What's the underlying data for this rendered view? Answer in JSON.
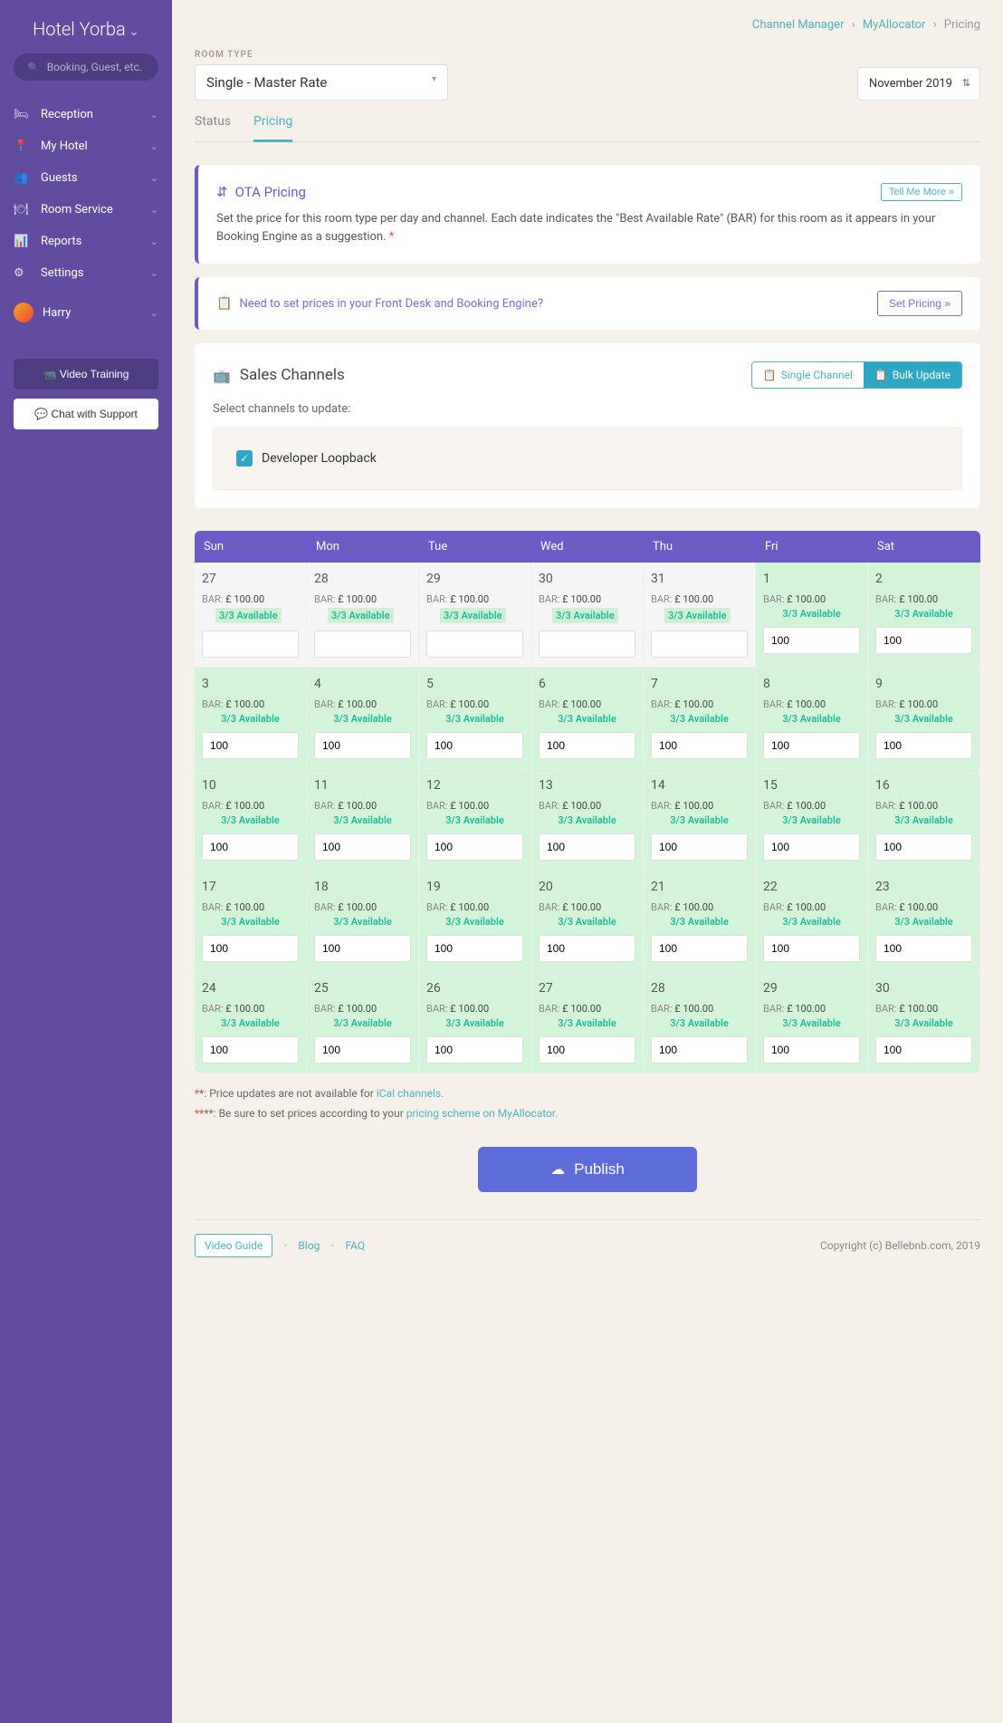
{
  "sidebar": {
    "hotel_name": "Hotel Yorba",
    "search_placeholder": "Booking, Guest, etc.",
    "nav": [
      {
        "icon": "🛏",
        "label": "Reception"
      },
      {
        "icon": "📍",
        "label": "My Hotel"
      },
      {
        "icon": "👥",
        "label": "Guests"
      },
      {
        "icon": "🍽",
        "label": "Room Service"
      },
      {
        "icon": "📊",
        "label": "Reports"
      },
      {
        "icon": "⚙",
        "label": "Settings"
      }
    ],
    "user": "Harry",
    "video_training": "Video Training",
    "chat_support": "Chat with Support"
  },
  "breadcrumb": {
    "channel_manager": "Channel Manager",
    "myallocator": "MyAllocator",
    "pricing": "Pricing"
  },
  "room_type_label": "ROOM TYPE",
  "room_type_value": "Single - Master Rate",
  "month_value": "November 2019",
  "tabs": {
    "status": "Status",
    "pricing": "Pricing"
  },
  "ota_card": {
    "title": "OTA Pricing",
    "tell_more": "Tell Me More »",
    "text": "Set the price for this room type per day and channel. Each date indicates the \"Best Available Rate\" (BAR) for this room as it appears in your Booking Engine as a suggestion."
  },
  "prompt_card": {
    "text": "Need to set prices in your Front Desk and Booking Engine?",
    "button": "Set Pricing »"
  },
  "sales": {
    "title": "Sales Channels",
    "single": "Single Channel",
    "bulk": "Bulk Update",
    "select_label": "Select channels to update:",
    "channel": "Developer Loopback"
  },
  "calendar": {
    "days": [
      "Sun",
      "Mon",
      "Tue",
      "Wed",
      "Thu",
      "Fri",
      "Sat"
    ],
    "bar_label": "BAR:",
    "bar_value": "£ 100.00",
    "avail": "3/3 Available",
    "input_value": "100",
    "cells": [
      {
        "date": "27",
        "prev": true
      },
      {
        "date": "28",
        "prev": true
      },
      {
        "date": "29",
        "prev": true
      },
      {
        "date": "30",
        "prev": true
      },
      {
        "date": "31",
        "prev": true
      },
      {
        "date": "1",
        "prev": false
      },
      {
        "date": "2",
        "prev": false
      },
      {
        "date": "3",
        "prev": false
      },
      {
        "date": "4",
        "prev": false
      },
      {
        "date": "5",
        "prev": false
      },
      {
        "date": "6",
        "prev": false
      },
      {
        "date": "7",
        "prev": false
      },
      {
        "date": "8",
        "prev": false
      },
      {
        "date": "9",
        "prev": false
      },
      {
        "date": "10",
        "prev": false
      },
      {
        "date": "11",
        "prev": false
      },
      {
        "date": "12",
        "prev": false
      },
      {
        "date": "13",
        "prev": false
      },
      {
        "date": "14",
        "prev": false
      },
      {
        "date": "15",
        "prev": false
      },
      {
        "date": "16",
        "prev": false
      },
      {
        "date": "17",
        "prev": false
      },
      {
        "date": "18",
        "prev": false
      },
      {
        "date": "19",
        "prev": false
      },
      {
        "date": "20",
        "prev": false
      },
      {
        "date": "21",
        "prev": false
      },
      {
        "date": "22",
        "prev": false
      },
      {
        "date": "23",
        "prev": false
      },
      {
        "date": "24",
        "prev": false
      },
      {
        "date": "25",
        "prev": false
      },
      {
        "date": "26",
        "prev": false
      },
      {
        "date": "27",
        "prev": false
      },
      {
        "date": "28",
        "prev": false
      },
      {
        "date": "29",
        "prev": false
      },
      {
        "date": "30",
        "prev": false
      }
    ]
  },
  "footnote1": {
    "prefix": "*: Price updates are not available for ",
    "link": "iCal channels."
  },
  "footnote2": {
    "prefix": "**: Be sure to set prices according to your ",
    "link": "pricing scheme on MyAllocator."
  },
  "publish": "Publish",
  "footer": {
    "video_guide": "Video Guide",
    "blog": "Blog",
    "faq": "FAQ",
    "copyright": "Copyright (c) Bellebnb.com, 2019"
  }
}
